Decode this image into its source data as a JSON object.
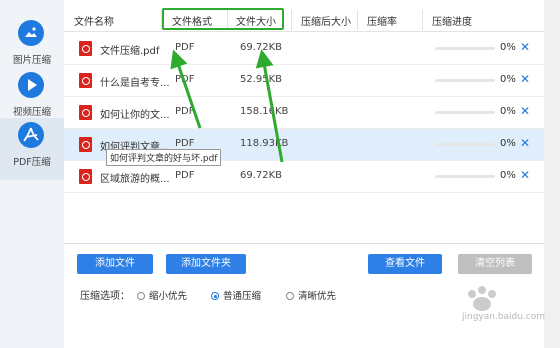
{
  "sidebar": {
    "items": [
      {
        "label": "图片压缩",
        "icon": "image-icon"
      },
      {
        "label": "视频压缩",
        "icon": "play-icon"
      },
      {
        "label": "PDF压缩",
        "icon": "pdf-icon"
      }
    ]
  },
  "table": {
    "headers": [
      "文件名称",
      "文件格式",
      "文件大小",
      "压缩后大小",
      "压缩率",
      "压缩进度"
    ],
    "rows": [
      {
        "name": "文件压缩.pdf",
        "format": "PDF",
        "size": "69.72KB",
        "progress": "0%",
        "progress_value": 0
      },
      {
        "name": "什么是自考专...",
        "format": "PDF",
        "size": "52.95KB",
        "progress": "0%",
        "progress_value": 0
      },
      {
        "name": "如何让你的文...",
        "format": "PDF",
        "size": "158.16KB",
        "progress": "0%",
        "progress_value": 0
      },
      {
        "name": "如何评判文章...",
        "format": "PDF",
        "size": "118.93KB",
        "progress": "0%",
        "progress_value": 0
      },
      {
        "name": "区域旅游的概...",
        "format": "PDF",
        "size": "69.72KB",
        "progress": "0%",
        "progress_value": 0
      }
    ],
    "tooltip": "如何评判文章的好与坏.pdf",
    "delete_glyph": "✕"
  },
  "buttons": {
    "add_file": "添加文件",
    "add_folder": "添加文件夹",
    "view_file": "查看文件",
    "clear_list": "清空列表"
  },
  "options": {
    "label": "压缩选项：",
    "choices": [
      "缩小优先",
      "普通压缩",
      "清晰优先"
    ],
    "selected": "普通压缩"
  },
  "watermark": {
    "text": "jingyan.baidu.com"
  },
  "colors": {
    "accent": "#1f7ae0",
    "button": "#2e7fe6",
    "annotation": "#2eaa2e",
    "pdf_red": "#d9251c",
    "selected_row": "#dfeefa"
  }
}
